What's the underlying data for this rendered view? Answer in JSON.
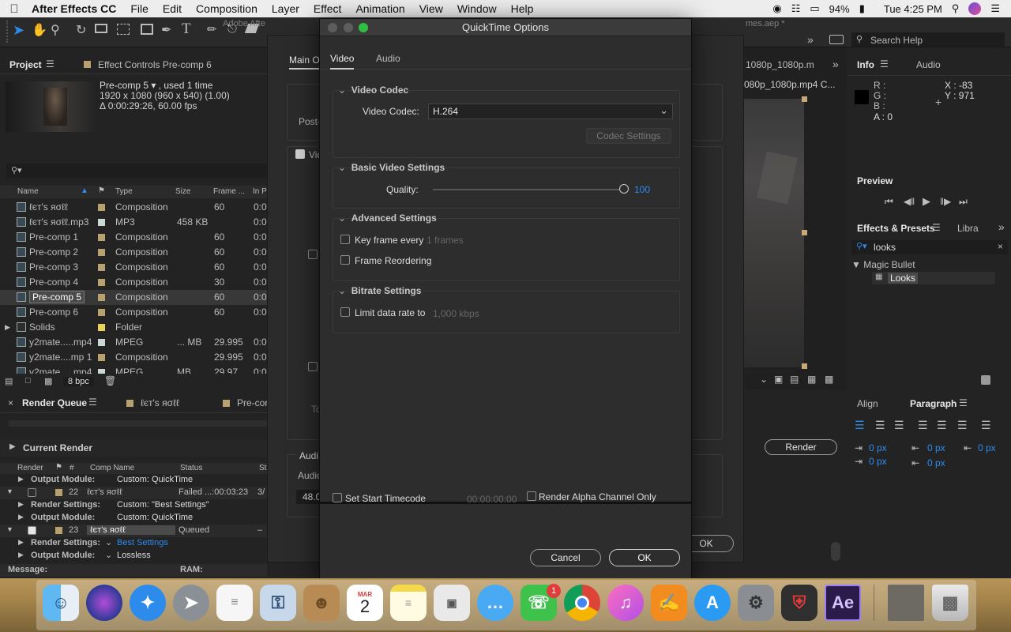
{
  "menubar": {
    "app": "After Effects CC",
    "items": [
      "File",
      "Edit",
      "Composition",
      "Layer",
      "Effect",
      "Animation",
      "View",
      "Window",
      "Help"
    ],
    "battery": "94%",
    "clock": "Tue 4:25 PM"
  },
  "toolbar": {
    "title_fragment": "Adobe Afte",
    "file_fragment": "mes.aep *",
    "search_help": "Search Help"
  },
  "project": {
    "tab": "Project",
    "effect_controls_tab": "Effect Controls Pre-comp 6",
    "thumb_name": "Pre-comp 5 ▾ , used 1 time",
    "thumb_dims": "1920 x 1080  (960 x 540) (1.00)",
    "thumb_dur": "Δ 0:00:29:26, 60.00 fps",
    "columns": [
      "Name",
      "Type",
      "Size",
      "Frame ...",
      "In P"
    ],
    "rows": [
      {
        "name": "ℓєт'ѕ яσℓℓ",
        "type": "Composition",
        "size": "",
        "fps": "60",
        "in": "0:0",
        "color": "#b8a170"
      },
      {
        "name": "ℓєт'ѕ яσℓℓ.mp3",
        "type": "MP3",
        "size": "458 KB",
        "fps": "",
        "in": "0:0",
        "color": "#c9d7d6"
      },
      {
        "name": "Pre-comp 1",
        "type": "Composition",
        "size": "",
        "fps": "60",
        "in": "0:0",
        "color": "#b8a170"
      },
      {
        "name": "Pre-comp 2",
        "type": "Composition",
        "size": "",
        "fps": "60",
        "in": "0:0",
        "color": "#b8a170"
      },
      {
        "name": "Pre-comp 3",
        "type": "Composition",
        "size": "",
        "fps": "60",
        "in": "0:0",
        "color": "#b8a170"
      },
      {
        "name": "Pre-comp 4",
        "type": "Composition",
        "size": "",
        "fps": "30",
        "in": "0:0",
        "color": "#b8a170"
      },
      {
        "name": "Pre-comp 5",
        "type": "Composition",
        "size": "",
        "fps": "60",
        "in": "0:0",
        "color": "#b8a170"
      },
      {
        "name": "Pre-comp 6",
        "type": "Composition",
        "size": "",
        "fps": "60",
        "in": "0:0",
        "color": "#b8a170"
      },
      {
        "name": "Solids",
        "type": "Folder",
        "size": "",
        "fps": "",
        "in": "",
        "color": "#e8d35a"
      },
      {
        "name": "y2mate.....mp4",
        "type": "MPEG",
        "size": "... MB",
        "fps": "29.995",
        "in": "0:0",
        "color": "#c9d7d6"
      },
      {
        "name": "y2mate....mp 1",
        "type": "Composition",
        "size": "",
        "fps": "29.995",
        "in": "0:0",
        "color": "#b8a170"
      },
      {
        "name": "y2mate.....mp4",
        "type": "MPEG",
        "size": "MB",
        "fps": "29.97",
        "in": "0:0",
        "color": "#c9d7d6"
      }
    ],
    "bpc": "8 bpc"
  },
  "render_queue": {
    "tab": "Render Queue",
    "tab2": "ℓєт'ѕ яσℓℓ",
    "tab3": "Pre-con",
    "current_render": "Current Render",
    "columns": [
      "Render",
      "#",
      "Comp Name",
      "Status",
      "St"
    ],
    "lines": [
      {
        "label": "Output Module:",
        "value": "Custom: QuickTime"
      },
      {
        "num": "22",
        "comp": "ℓєт'ѕ яσℓℓ",
        "status": "Failed ...:00:03:23",
        "extra": "3/"
      },
      {
        "label": "Render Settings:",
        "value": "Custom: \"Best Settings\""
      },
      {
        "label": "Output Module:",
        "value": "Custom: QuickTime"
      },
      {
        "num": "23",
        "comp": "ℓєт'ѕ яσℓℓ",
        "status": "Queued",
        "extra": "–"
      },
      {
        "label": "Render Settings:",
        "value": "Best Settings"
      },
      {
        "label": "Output Module:",
        "value": "Lossless"
      }
    ],
    "message": "Message:",
    "ram": "RAM:"
  },
  "right": {
    "comp_tab": "1080p_1080p.m",
    "comp_title": "080p_1080p.mp4 C...",
    "info_tab": "Info",
    "audio_tab": "Audio",
    "r": "R :",
    "g": "G :",
    "b": "B :",
    "a": "A : 0",
    "x": "X : -83",
    "y": "Y : 971",
    "preview": "Preview",
    "effects_tab": "Effects & Presets",
    "libra_tab": "Libra",
    "search_value": "looks",
    "magic_bullet": "Magic Bullet",
    "looks_item": "Looks",
    "align": "Align",
    "paragraph": "Paragraph",
    "px1": "0 px",
    "px2": "0 px",
    "px3": "0 px",
    "px4": "0 px",
    "px5": "0 px",
    "render_btn": "Render"
  },
  "output_dialog": {
    "main_tab": "Main Op",
    "post": "Post-",
    "vid": "Vid",
    "audi": "Audi",
    "audio_label": "Audio",
    "sample": "48.0",
    "to": "To",
    "ok": "OK"
  },
  "qt": {
    "title": "QuickTime Options",
    "tabs": [
      "Video",
      "Audio"
    ],
    "codec_group": "Video Codec",
    "codec_label": "Video Codec:",
    "codec_value": "H.264",
    "codec_settings": "Codec Settings",
    "basic_group": "Basic Video Settings",
    "quality_label": "Quality:",
    "quality_value": "100",
    "quality_fraction": 1.0,
    "advanced_group": "Advanced Settings",
    "keyframe_label": "Key frame every",
    "keyframe_value": "1 frames",
    "reorder_label": "Frame Reordering",
    "bitrate_group": "Bitrate Settings",
    "limit_label": "Limit data rate to",
    "limit_value": "1,000 kbps",
    "start_tc_label": "Set Start Timecode",
    "start_tc_value": "00:00:00:00",
    "alpha_label": "Render Alpha Channel Only",
    "cancel": "Cancel",
    "ok": "OK"
  },
  "dock": {
    "calendar_month": "MAR",
    "calendar_day": "2",
    "facetime_badge": "1",
    "ae_label": "Ae"
  }
}
